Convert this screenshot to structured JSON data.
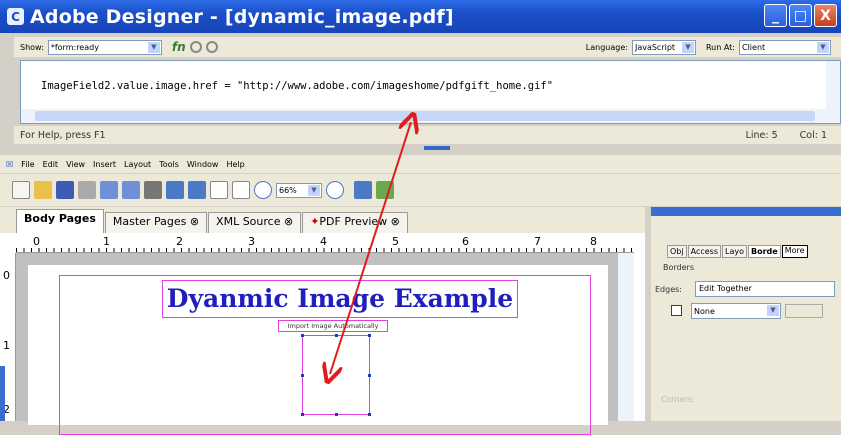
{
  "window": {
    "title": "Adobe Designer - [dynamic_image.pdf]",
    "minimize": "_",
    "maximize": "□",
    "close": "X"
  },
  "script_editor": {
    "show_label": "Show:",
    "show_value": "*form:ready",
    "language_label": "Language:",
    "language_value": "JavaScript",
    "run_at_label": "Run At:",
    "run_at_value": "Client",
    "code_line": "ImageField2.value.image.href = \"http://www.adobe.com/imageshome/pdfgift_home.gif\"",
    "status_help": "For Help, press F1",
    "status_line": "Line: 5",
    "status_col": "Col: 1"
  },
  "menu": {
    "items": [
      "File",
      "Edit",
      "View",
      "Insert",
      "Layout",
      "Tools",
      "Window",
      "Help"
    ]
  },
  "toolbar": {
    "zoom": "66%"
  },
  "tabs": [
    {
      "label": "Body Pages"
    },
    {
      "label": "Master Pages"
    },
    {
      "label": "XML Source"
    },
    {
      "label": "PDF Preview"
    }
  ],
  "ruler": {
    "labels": [
      "0",
      "1",
      "2",
      "3",
      "4",
      "5",
      "6",
      "7",
      "8"
    ],
    "vlabels": [
      "0",
      "1",
      "2"
    ]
  },
  "page": {
    "title": "Dyanmic Image Example",
    "image_label": "Import Image Automatically"
  },
  "right_panel": {
    "tabs": [
      "Obj",
      "Access",
      "Layo",
      "Borde"
    ],
    "more": "More",
    "section": "Borders",
    "edges_label": "Edges:",
    "edges_value": "Edit Together",
    "style_value": "None",
    "corners_label": "Corners:"
  }
}
